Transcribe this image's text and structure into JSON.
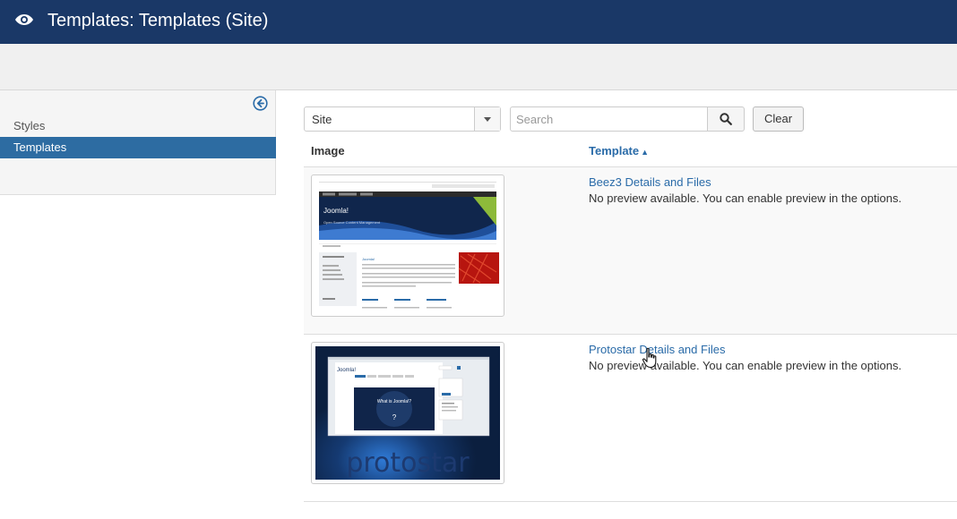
{
  "header": {
    "title": "Templates: Templates (Site)",
    "icon": "eye-icon",
    "bg_color": "#1a3867"
  },
  "sidebar": {
    "collapse_icon": "arrow-circle-left-icon",
    "items": [
      {
        "label": "Styles",
        "active": false
      },
      {
        "label": "Templates",
        "active": true
      }
    ]
  },
  "filters": {
    "client_select_value": "Site",
    "search_placeholder": "Search",
    "search_value": "",
    "clear_label": "Clear"
  },
  "table": {
    "columns": {
      "image": "Image",
      "template": "Template",
      "template_sort": "▲"
    },
    "rows": [
      {
        "thumbnail": "beez3-thumbnail",
        "link": "Beez3 Details and Files",
        "description": "No preview available. You can enable preview in the options."
      },
      {
        "thumbnail": "protostar-thumbnail",
        "link": "Protostar Details and Files",
        "description": "No preview available. You can enable preview in the options."
      }
    ]
  },
  "thumbnails": {
    "beez3": {
      "logo": "Joomla!",
      "tagline": "Open Source Content Management",
      "heading": "Joomla!"
    },
    "protostar": {
      "logo": "Joomla!",
      "hero": "What is Joomla!?",
      "brand": "protostar"
    }
  }
}
